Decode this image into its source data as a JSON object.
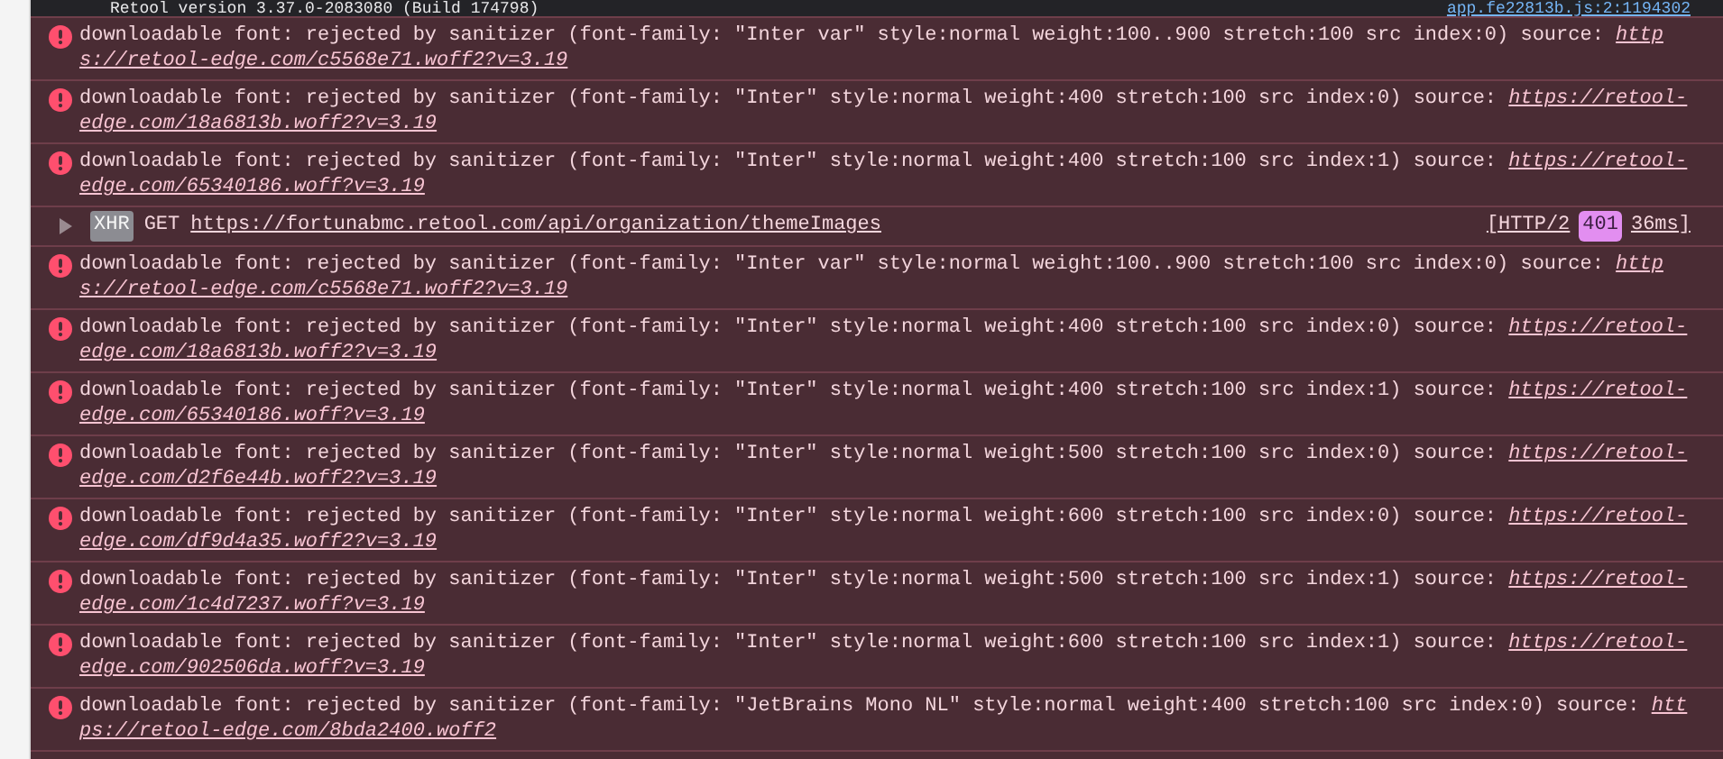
{
  "console": {
    "header": {
      "text": "Retool version 3.37.0-2083080 (Build 174798)",
      "source": "app.fe22813b.js:2:1194302"
    },
    "entries": [
      {
        "kind": "error",
        "message": "downloadable font: rejected by sanitizer (font-family: \"Inter var\" style:normal weight:100..900 stretch:100 src index:0) source: ",
        "link_parts": [
          "http",
          "s://retool-edge.com/c5568e71.woff2?v=3.19"
        ]
      },
      {
        "kind": "error",
        "message": "downloadable font: rejected by sanitizer (font-family: \"Inter\" style:normal weight:400 stretch:100 src index:0) source: ",
        "link_parts": [
          "https://retool-",
          "edge.com/18a6813b.woff2?v=3.19"
        ]
      },
      {
        "kind": "error",
        "message": "downloadable font: rejected by sanitizer (font-family: \"Inter\" style:normal weight:400 stretch:100 src index:1) source: ",
        "link_parts": [
          "https://retool-",
          "edge.com/65340186.woff?v=3.19"
        ]
      },
      {
        "kind": "request",
        "expanded": false,
        "type": "XHR",
        "method": "GET",
        "url": "https://fortunabmc.retool.com/api/organization/themeImages",
        "protocol": "[HTTP/2",
        "status": "401",
        "time": "36ms]"
      },
      {
        "kind": "error",
        "message": "downloadable font: rejected by sanitizer (font-family: \"Inter var\" style:normal weight:100..900 stretch:100 src index:0) source: ",
        "link_parts": [
          "http",
          "s://retool-edge.com/c5568e71.woff2?v=3.19"
        ]
      },
      {
        "kind": "error",
        "message": "downloadable font: rejected by sanitizer (font-family: \"Inter\" style:normal weight:400 stretch:100 src index:0) source: ",
        "link_parts": [
          "https://retool-",
          "edge.com/18a6813b.woff2?v=3.19"
        ]
      },
      {
        "kind": "error",
        "message": "downloadable font: rejected by sanitizer (font-family: \"Inter\" style:normal weight:400 stretch:100 src index:1) source: ",
        "link_parts": [
          "https://retool-",
          "edge.com/65340186.woff?v=3.19"
        ]
      },
      {
        "kind": "error",
        "message": "downloadable font: rejected by sanitizer (font-family: \"Inter\" style:normal weight:500 stretch:100 src index:0) source: ",
        "link_parts": [
          "https://retool-",
          "edge.com/d2f6e44b.woff2?v=3.19"
        ]
      },
      {
        "kind": "error",
        "message": "downloadable font: rejected by sanitizer (font-family: \"Inter\" style:normal weight:600 stretch:100 src index:0) source: ",
        "link_parts": [
          "https://retool-",
          "edge.com/df9d4a35.woff2?v=3.19"
        ]
      },
      {
        "kind": "error",
        "message": "downloadable font: rejected by sanitizer (font-family: \"Inter\" style:normal weight:500 stretch:100 src index:1) source: ",
        "link_parts": [
          "https://retool-",
          "edge.com/1c4d7237.woff?v=3.19"
        ]
      },
      {
        "kind": "error",
        "message": "downloadable font: rejected by sanitizer (font-family: \"Inter\" style:normal weight:600 stretch:100 src index:1) source: ",
        "link_parts": [
          "https://retool-",
          "edge.com/902506da.woff?v=3.19"
        ]
      },
      {
        "kind": "error",
        "message": "downloadable font: rejected by sanitizer (font-family: \"JetBrains Mono NL\" style:normal weight:400 stretch:100 src index:0) source: ",
        "link_parts": [
          "htt",
          "ps://retool-edge.com/8bda2400.woff2"
        ]
      }
    ]
  }
}
